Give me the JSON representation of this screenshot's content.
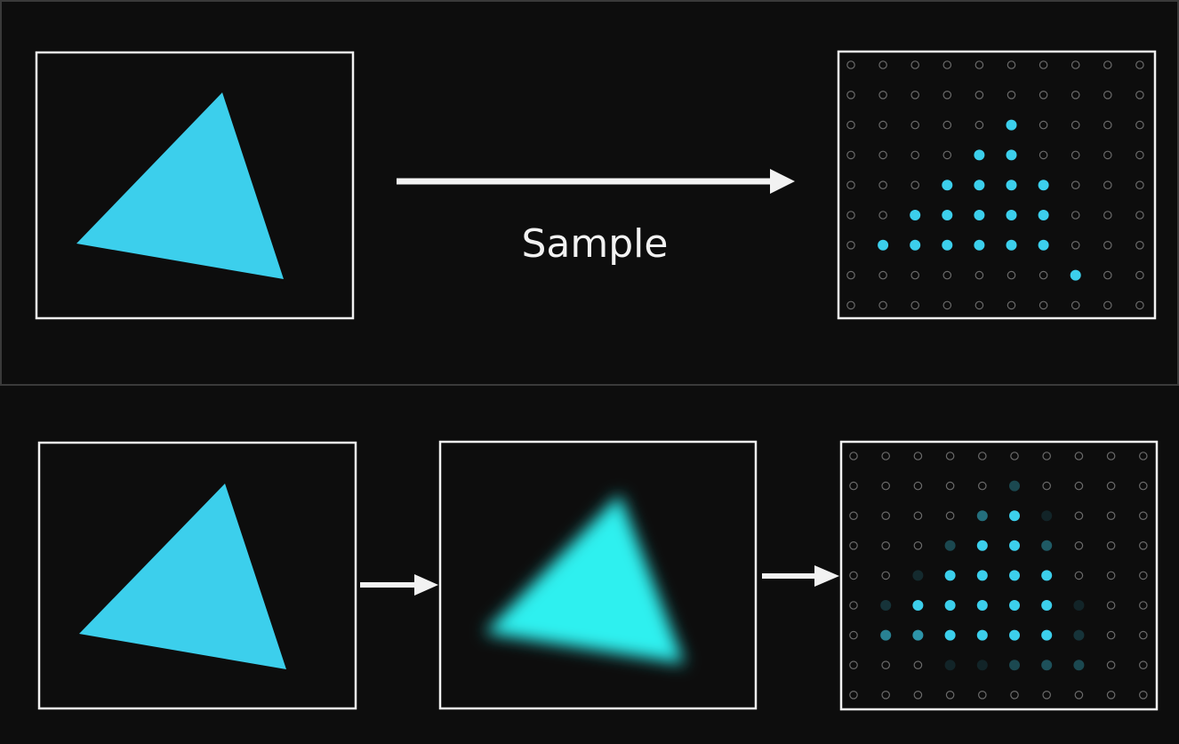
{
  "colors": {
    "background": "#0d0d0d",
    "panel_border": "#3a3a3a",
    "frame": "#f2f2f2",
    "triangle": "#3ccfec",
    "blurred_triangle": "#2ff0ef",
    "sample_on": "#3ccfec",
    "sample_off": "#6a6a6a",
    "arrow": "#f2f2f2"
  },
  "top_panel": {
    "arrow_label": "Sample",
    "grid": {
      "cols": 10,
      "rows": 9,
      "samples": [
        [
          0,
          0,
          0,
          0,
          0,
          0,
          0,
          0,
          0,
          0
        ],
        [
          0,
          0,
          0,
          0,
          0,
          0,
          0,
          0,
          0,
          0
        ],
        [
          0,
          0,
          0,
          0,
          0,
          1,
          0,
          0,
          0,
          0
        ],
        [
          0,
          0,
          0,
          0,
          1,
          1,
          0,
          0,
          0,
          0
        ],
        [
          0,
          0,
          0,
          1,
          1,
          1,
          1,
          0,
          0,
          0
        ],
        [
          0,
          0,
          1,
          1,
          1,
          1,
          1,
          0,
          0,
          0
        ],
        [
          0,
          1,
          1,
          1,
          1,
          1,
          1,
          0,
          0,
          0
        ],
        [
          0,
          0,
          0,
          0,
          0,
          0,
          0,
          1,
          0,
          0
        ],
        [
          0,
          0,
          0,
          0,
          0,
          0,
          0,
          0,
          0,
          0
        ]
      ]
    }
  },
  "bottom_panel": {
    "grid": {
      "cols": 10,
      "rows": 9,
      "samples": [
        [
          0,
          0,
          0,
          0,
          0,
          0,
          0,
          0,
          0,
          0
        ],
        [
          0,
          0,
          0,
          0,
          0,
          0.3,
          0,
          0,
          0,
          0
        ],
        [
          0,
          0,
          0,
          0,
          0.5,
          1,
          0.1,
          0,
          0,
          0
        ],
        [
          0,
          0,
          0,
          0.3,
          1,
          1,
          0.4,
          0,
          0,
          0
        ],
        [
          0,
          0,
          0.15,
          1,
          1,
          1,
          1,
          0,
          0,
          0
        ],
        [
          0,
          0.2,
          1,
          1,
          1,
          1,
          1,
          0.05,
          0,
          0
        ],
        [
          0,
          0.6,
          0.7,
          1,
          1,
          1,
          1,
          0.2,
          0,
          0
        ],
        [
          0,
          0,
          0,
          0.08,
          0.12,
          0.3,
          0.35,
          0.3,
          0,
          0
        ],
        [
          0,
          0,
          0,
          0,
          0,
          0,
          0,
          0,
          0,
          0
        ]
      ]
    }
  }
}
